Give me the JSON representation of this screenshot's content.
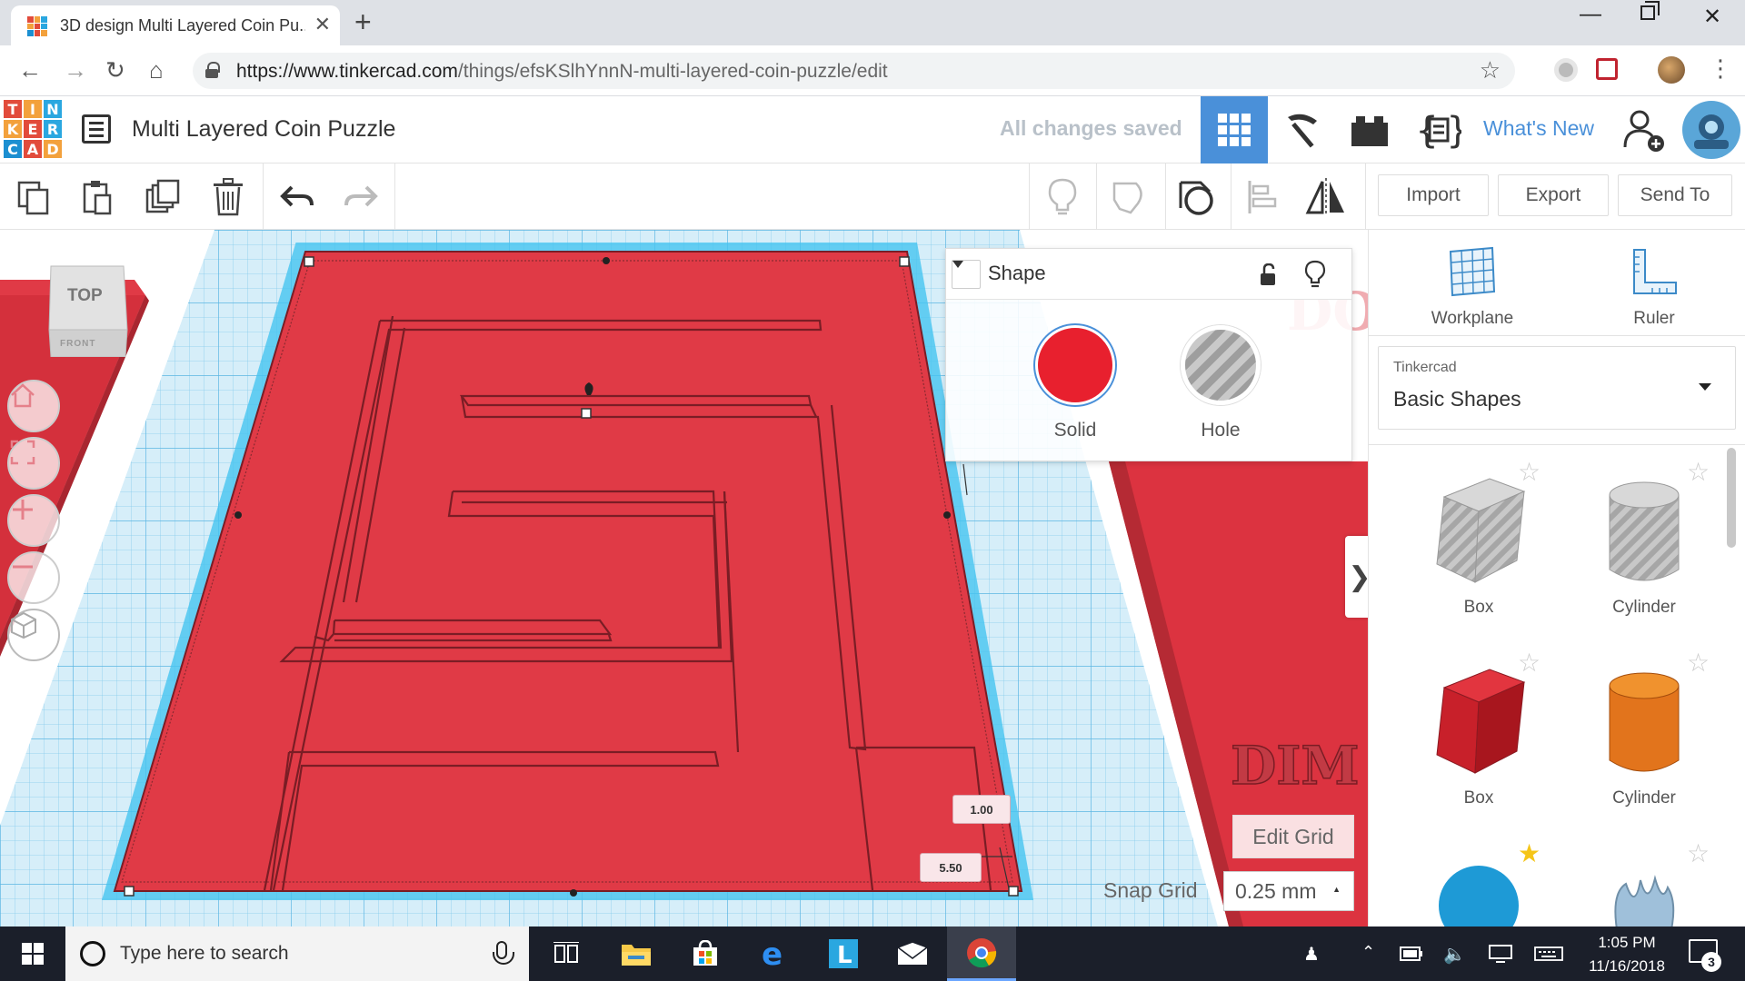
{
  "browser": {
    "tab_title": "3D design Multi Layered Coin Pu...",
    "new_tab_symbol": "+",
    "close_symbol": "✕",
    "url_host": "https://www.tinkercad.com",
    "url_path": "/things/efsKSlhYnnN-multi-layered-coin-puzzle/edit"
  },
  "app": {
    "logo_letters": [
      "T",
      "I",
      "N",
      "K",
      "E",
      "R",
      "C",
      "A",
      "D"
    ],
    "logo_colors": [
      "#e24b3b",
      "#f3a13c",
      "#2aa7e0",
      "#f3a13c",
      "#e24b3b",
      "#2aa7e0",
      "#1c8fd1",
      "#e24b3b",
      "#f3a13c"
    ],
    "project_title": "Multi Layered Coin Puzzle",
    "save_status": "All changes saved",
    "whats_new": "What's New",
    "accent_color": "#4a90d9"
  },
  "toolbar": {
    "icons": [
      "copy-icon",
      "paste-icon",
      "duplicate-icon",
      "delete-icon",
      "undo-icon",
      "redo-icon",
      "note-icon",
      "comment-icon",
      "view-icon",
      "align-icon",
      "mirror-icon"
    ],
    "import_label": "Import",
    "export_label": "Export",
    "send_to_label": "Send To"
  },
  "viewcube": {
    "top": "TOP",
    "front": "FRONT"
  },
  "inspector": {
    "title": "Shape",
    "solid_label": "Solid",
    "hole_label": "Hole",
    "solid_color": "#e8202e"
  },
  "workplane": {
    "dim_height": "1.00",
    "dim_width": "5.50",
    "edit_grid": "Edit Grid",
    "snap_grid_label": "Snap Grid",
    "snap_grid_value": "0.25 mm"
  },
  "shapes_panel": {
    "workplane_label": "Workplane",
    "ruler_label": "Ruler",
    "library_group": "Tinkercad",
    "library_name": "Basic Shapes",
    "items": [
      {
        "label": "Box"
      },
      {
        "label": "Cylinder"
      },
      {
        "label": "Box"
      },
      {
        "label": "Cylinder"
      }
    ]
  },
  "taskbar": {
    "search_placeholder": "Type here to search",
    "time": "1:05 PM",
    "date": "11/16/2018",
    "notifications": "3"
  }
}
